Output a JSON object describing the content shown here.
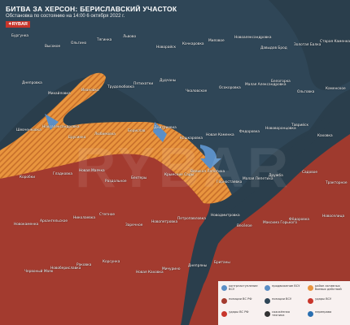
{
  "header": {
    "title": "БИТВА ЗА ХЕРСОН: БЕРИСЛАВСКИЙ УЧАСТОК",
    "subtitle": "Обстановка по состоянию на 14:00 6 октября 2022 г.",
    "brand": "✦RYBAR"
  },
  "watermark": "RYBAR",
  "colors": {
    "ukr_zone": "#2f4657",
    "ru_zone": "#a33b2f",
    "water": "#2a3e4c",
    "contested": "#e9953e",
    "advance_arrow": "#5b8fc6",
    "brand": "#c8352b"
  },
  "places": [
    "Бургунка",
    "Высокое",
    "Ольгино",
    "Тягинка",
    "Львово",
    "Новорайск",
    "Качкаровка",
    "Миловое",
    "Новоалександровка",
    "Давыдов Брод",
    "Золотая Балка",
    "Старая Каменка",
    "Днепровка",
    "Михайловка",
    "Ивановка",
    "Трудолюбовка",
    "Пятихатки",
    "Дудчаны",
    "Чкаловское",
    "Осокоровка",
    "Малая Александровка",
    "Белогорка",
    "Ольговка",
    "Каменское",
    "Шевченковка",
    "Новоалександровка",
    "Брусинка",
    "Любимовка",
    "Берислав",
    "Дмитриевка",
    "Кошкаровка",
    "Новая Каменка",
    "Федоровка",
    "Нововоронцовка",
    "Таврийск",
    "Каховка",
    "Коробки",
    "Гладковка",
    "Новая Маячка",
    "Раздольное",
    "Бехтеры",
    "Крымские Сады",
    "Великая Лепетиха",
    "Горностаевка",
    "Малая Лепетиха",
    "Дружба",
    "Садовое",
    "Тракторное",
    "Новокаменка",
    "Архангельское",
    "Николаевка",
    "Степное",
    "Заречное",
    "Новопетровка",
    "Петропавловка",
    "Новодмитровка",
    "Весёлое",
    "Максима Горького",
    "Фёдоровка",
    "Новоселица",
    "Червоный Маяк",
    "Новобериславка",
    "Раковка",
    "Корсунка",
    "Новая Каховка",
    "Мичурино",
    "Днепряны",
    "Британы"
  ],
  "legend": [
    {
      "text": "контрнаступление ВСУ",
      "color": "#5b8fc6"
    },
    {
      "text": "продвижение ВСУ",
      "color": "#5b8fc6"
    },
    {
      "text": "район активных боевых действий",
      "color": "#e9953e"
    },
    {
      "text": "позиции ВС РФ",
      "color": "#a33b2f"
    },
    {
      "text": "позиции ВСУ",
      "color": "#2f4657"
    },
    {
      "text": "удары ВСУ",
      "color": "#c8352b"
    },
    {
      "text": "удары ВС РФ",
      "color": "#c8352b"
    },
    {
      "text": "сожжённая техника",
      "color": "#333333"
    },
    {
      "text": "переправа",
      "color": "#2a6fb0"
    }
  ]
}
